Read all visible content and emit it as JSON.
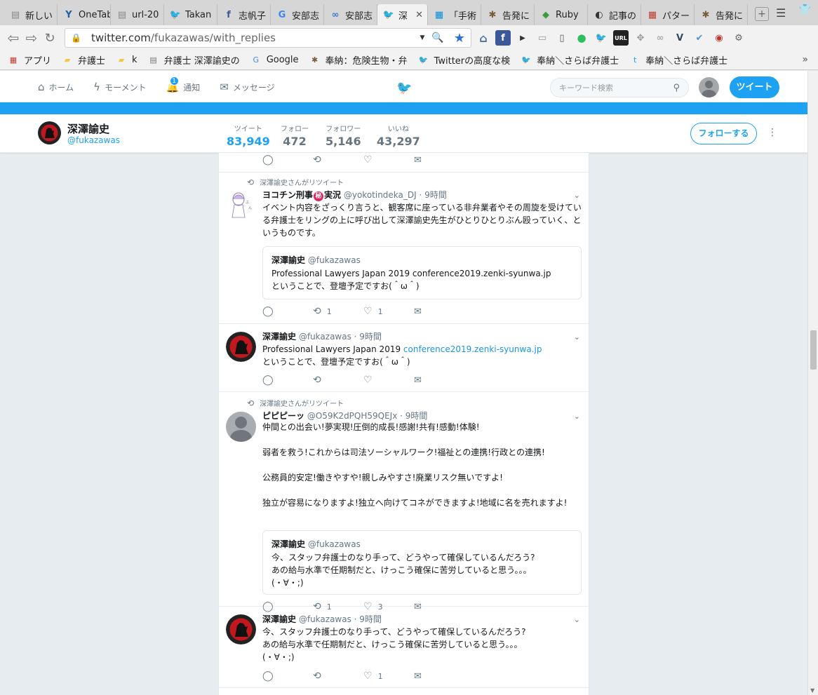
{
  "browser": {
    "tabs": [
      {
        "title": "新しい",
        "icon": "doc-icon",
        "color": "#888888"
      },
      {
        "title": "OneTab",
        "icon": "onetab-icon",
        "color": "#1f5fa8"
      },
      {
        "title": "url-20",
        "icon": "doc-icon",
        "color": "#888888"
      },
      {
        "title": "Takan",
        "icon": "twitter-icon",
        "color": "#1da1f2"
      },
      {
        "title": "志帆子",
        "icon": "facebook-icon",
        "color": "#3b5998"
      },
      {
        "title": "安部志",
        "icon": "google-icon",
        "color": "#4285f4"
      },
      {
        "title": "安部志",
        "icon": "link-icon",
        "color": "#3a7bd5"
      },
      {
        "title": "深",
        "icon": "twitter-icon",
        "color": "#1da1f2",
        "active": true
      },
      {
        "title": "「手術",
        "icon": "hatena-icon",
        "color": "#008fde"
      },
      {
        "title": "告発に",
        "icon": "bug-icon",
        "color": "#7a5c3a"
      },
      {
        "title": "Ruby",
        "icon": "ruby-icon",
        "color": "#3e9b3e"
      },
      {
        "title": "記事の",
        "icon": "circle-icon",
        "color": "#333333"
      },
      {
        "title": "パター",
        "icon": "grid-icon",
        "color": "#c0392b"
      },
      {
        "title": "告発に",
        "icon": "bug-icon",
        "color": "#7a5c3a"
      }
    ],
    "new_tab_label": "+",
    "url_domain": "twitter.com",
    "url_path": "/fukazawas/with_replies",
    "bookmarks": [
      {
        "label": "アプリ",
        "icon": "apps-grid-icon"
      },
      {
        "label": "弁護士",
        "icon": "folder-icon"
      },
      {
        "label": "k",
        "icon": "folder-icon"
      },
      {
        "label": "弁護士 深澤諭史の",
        "icon": "doc-icon"
      },
      {
        "label": "Google",
        "icon": "google-icon"
      },
      {
        "label": "奉納：危険生物・弁",
        "icon": "bug-icon"
      },
      {
        "label": "Twitterの高度な検",
        "icon": "twitter-icon"
      },
      {
        "label": "奉納＼さらば弁護士",
        "icon": "twitter-icon"
      },
      {
        "label": "奉納＼さらば弁護士",
        "icon": "t-icon"
      }
    ],
    "bookmarks_more": "»"
  },
  "twitter": {
    "nav": {
      "home": "ホーム",
      "moments": "モーメント",
      "notifications": "通知",
      "notifications_badge": "1",
      "messages": "メッセージ"
    },
    "search_placeholder": "キーワード検索",
    "tweet_button": "ツイート",
    "brand_color": "#1da1f2"
  },
  "profile": {
    "name": "深澤諭史",
    "handle": "@fukazawas",
    "stats": [
      {
        "label": "ツイート",
        "value": "83,949",
        "active": true
      },
      {
        "label": "フォロー",
        "value": "472"
      },
      {
        "label": "フォロワー",
        "value": "5,146"
      },
      {
        "label": "いいね",
        "value": "43,297"
      }
    ],
    "follow_button": "フォローする"
  },
  "tweets": [
    {
      "retweet_label": "深澤諭史さんがリツイート",
      "name_prefix": "ヨコチン刑事",
      "name_suffix": "実況",
      "name_badge": "秘",
      "handle": "@yokotindeka_DJ",
      "time": "· 9時間",
      "text": "イベント内容をざっくり言うと、観客席に座っている非弁業者やその周旋を受けている弁護士をリングの上に呼び出して深澤諭史先生がひとりひとりぶん殴っていく、というものです。",
      "quote": {
        "name": "深澤諭史",
        "handle": "@fukazawas",
        "text": "Professional Lawyers Japan 2019 conference2019.zenki-syunwa.jp\nということで、登壇予定ですお(＾ω＾)"
      },
      "retweets": "1",
      "likes": "1"
    },
    {
      "name": "深澤諭史",
      "handle": "@fukazawas",
      "time": "· 9時間",
      "text_before": "Professional Lawyers Japan 2019 ",
      "link": "conference2019.zenki-syunwa.jp",
      "text_after": "\nということで、登壇予定ですお(＾ω＾)",
      "retweets": "",
      "likes": ""
    },
    {
      "retweet_label": "深澤諭史さんがリツイート",
      "name": "ピピピーッ",
      "handle": "@O59K2dPQH59QEJx",
      "time": "· 9時間",
      "text": "仲間との出会い!夢実現!圧倒的成長!感謝!共有!感動!体験!\n\n弱者を救う!これからは司法ソーシャルワーク!福祉との連携!行政との連携!\n\n公務員的安定!働きやすや!親しみやすさ!廃業リスク無いですよ!\n\n独立が容易になりますよ!独立へ向けてコネができますよ!地域に名を売れますよ!",
      "quote": {
        "name": "深澤諭史",
        "handle": "@fukazawas",
        "text": "今、スタッフ弁護士のなり手って、どうやって確保しているんだろう?\nあの給与水準で任期制だと、けっこう確保に苦労していると思う。。。\n(・∀・;)"
      },
      "retweets": "1",
      "likes": "3"
    },
    {
      "name": "深澤諭史",
      "handle": "@fukazawas",
      "time": "· 9時間",
      "text": "今、スタッフ弁護士のなり手って、どうやって確保しているんだろう?\nあの給与水準で任期制だと、けっこう確保に苦労していると思う。。。\n(・∀・;)",
      "retweets": "",
      "likes": "1"
    }
  ]
}
